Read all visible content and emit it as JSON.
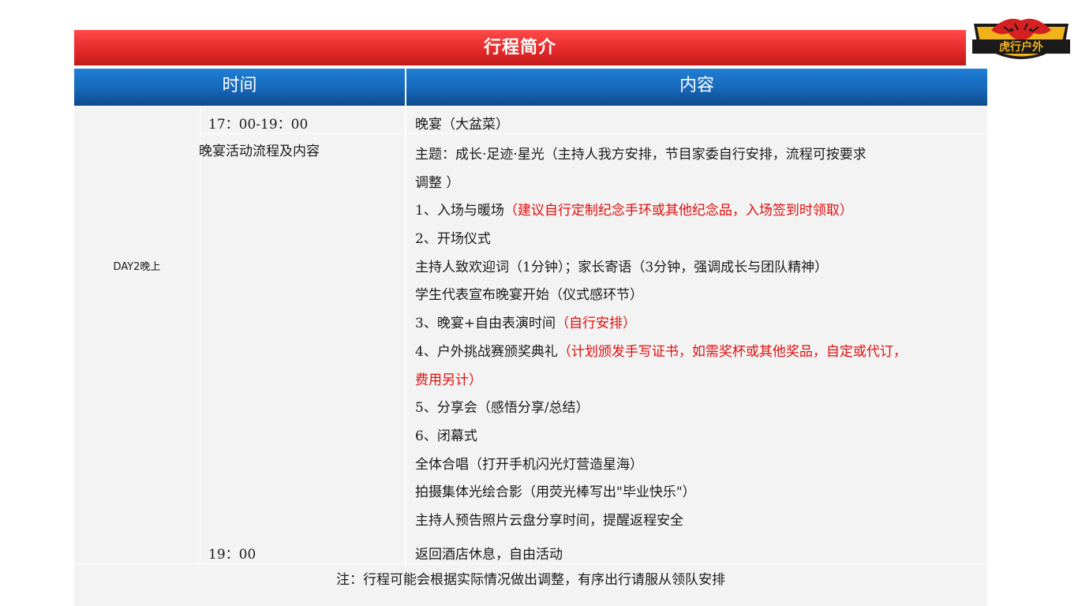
{
  "title": "行程简介",
  "header": {
    "time": "时间",
    "content": "内容"
  },
  "day_label": "DAY2晚上",
  "rows": [
    {
      "time": "17：00-19：00",
      "content": "晚宴（大盆菜）"
    },
    {
      "time": "晚宴活动流程及内容"
    },
    {
      "time": "19：00",
      "content": "返回酒店休息，自由活动"
    }
  ],
  "program_lines": [
    {
      "text": "主题：成长·足迹·星光（主持人我方安排，节目家委自行安排，流程可按要求",
      "red": ""
    },
    {
      "text": "调整 ）",
      "red": ""
    },
    {
      "text": "1、入场与暖场",
      "red": "（建议自行定制纪念手环或其他纪念品，入场签到时领取）"
    },
    {
      "text": "2、开场仪式",
      "red": ""
    },
    {
      "text": "主持人致欢迎词（1分钟）；家长寄语（3分钟，强调成长与团队精神）",
      "red": ""
    },
    {
      "text": "学生代表宣布晚宴开始（仪式感环节）",
      "red": ""
    },
    {
      "text": "3、晚宴+自由表演时间",
      "red": "（自行安排）"
    },
    {
      "text": "4、户外挑战赛颁奖典礼",
      "red": "（计划颁发手写证书，如需奖杯或其他奖品，自定或代订，"
    },
    {
      "text": "",
      "red": "费用另计）"
    },
    {
      "text": "5、分享会（感悟分享/总结）",
      "red": ""
    },
    {
      "text": "6、闭幕式",
      "red": ""
    },
    {
      "text": "全体合唱（打开手机闪光灯营造星海）",
      "red": ""
    },
    {
      "text": "拍摄集体光绘合影（用荧光棒写出\"毕业快乐\"）",
      "red": ""
    },
    {
      "text": "主持人预告照片云盘分享时间，提醒返程安全",
      "red": ""
    }
  ],
  "note": "注：行程可能会根据实际情况做出调整，有序出行请服从领队安排",
  "logo": {
    "text": "虎行户外",
    "icon": "tiger-logo-icon"
  },
  "colors": {
    "title_red": "#e52a2a",
    "header_blue": "#1767b8",
    "cell_bg": "#f3f3f3",
    "accent_red": "#e01010"
  }
}
